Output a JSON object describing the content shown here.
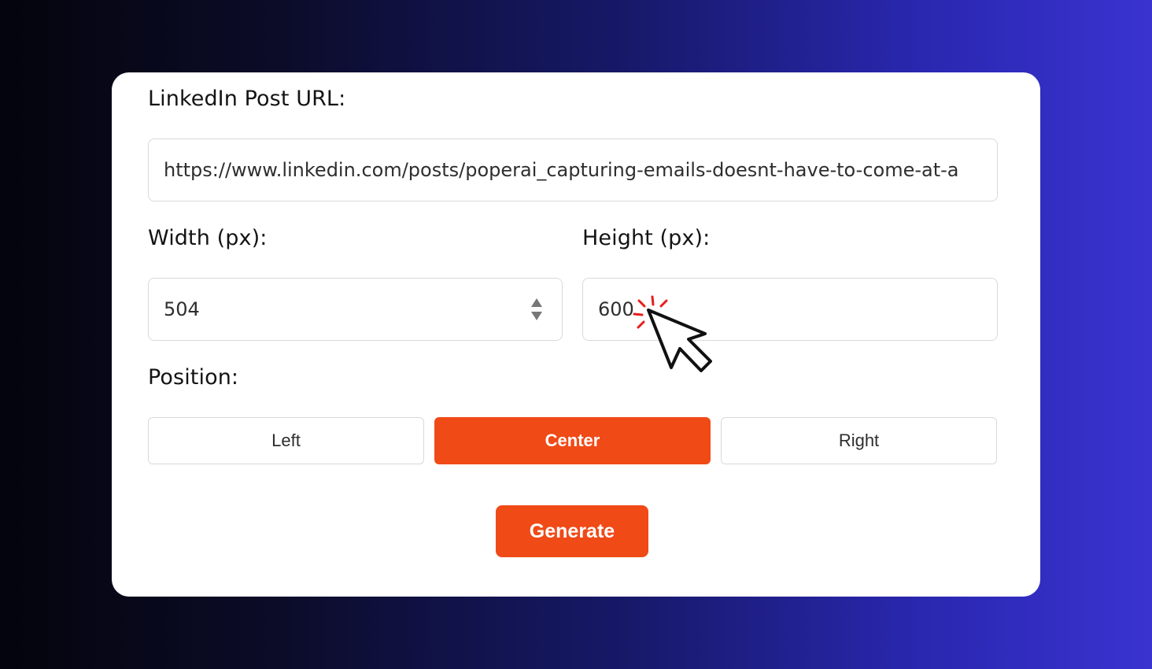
{
  "form": {
    "url_label": "LinkedIn Post URL:",
    "url_value": "https://www.linkedin.com/posts/poperai_capturing-emails-doesnt-have-to-come-at-a",
    "width_label": "Width (px):",
    "width_value": "504",
    "height_label": "Height (px):",
    "height_value": "600",
    "position_label": "Position:",
    "positions": [
      "Left",
      "Center",
      "Right"
    ],
    "selected_position": "Center",
    "generate_label": "Generate"
  },
  "colors": {
    "accent": "#f04a17",
    "card": "#ffffff",
    "border": "#d9d9d9",
    "click_spark": "#e81c1c"
  },
  "icons": {
    "stepper": "up-down-stepper-icon",
    "cursor": "mouse-pointer-click-icon"
  }
}
